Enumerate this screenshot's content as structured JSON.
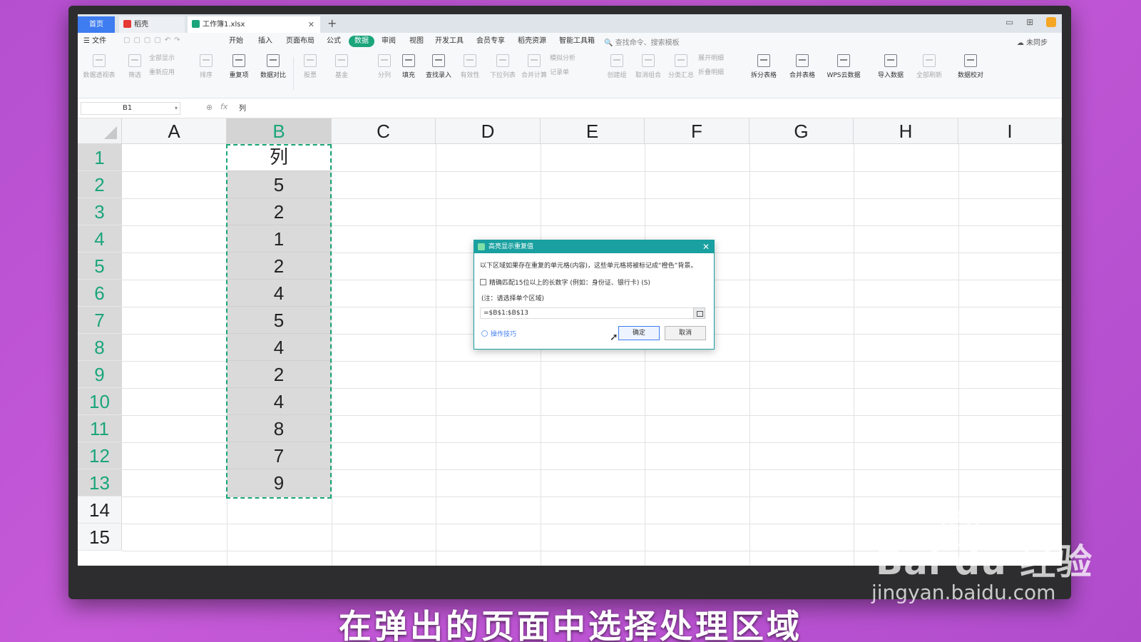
{
  "tabs": {
    "home": "首页",
    "docer": "稻壳",
    "workbook": "工作簿1.xlsx",
    "close": "✕",
    "add": "+"
  },
  "window": {
    "sync": "未同步"
  },
  "menu": {
    "file": "文件",
    "items": [
      "开始",
      "插入",
      "页面布局",
      "公式",
      "数据",
      "审阅",
      "视图",
      "开发工具",
      "会员专享",
      "稻壳资源",
      "智能工具箱"
    ],
    "active_index": 4,
    "search_placeholder": "查找命令、搜索模板"
  },
  "ribbon": {
    "buttons": [
      "数据透视表",
      "筛选",
      "全部显示",
      "重新应用",
      "排序",
      "重复项",
      "数据对比",
      "股票",
      "基金",
      "分列",
      "填充",
      "查找录入",
      "有效性",
      "下拉列表",
      "合并计算",
      "模拟分析",
      "记录单",
      "创建组",
      "取消组合",
      "分类汇总",
      "展开明细",
      "折叠明细",
      "拆分表格",
      "合并表格",
      "WPS云数据",
      "导入数据",
      "全部刷新",
      "数据校对"
    ]
  },
  "formula_bar": {
    "namebox": "B1",
    "fx": "fx",
    "value": "列"
  },
  "sheet": {
    "columns": [
      "A",
      "B",
      "C",
      "D",
      "E",
      "F",
      "G",
      "H",
      "I"
    ],
    "selected_column": "B",
    "rows": [
      "1",
      "2",
      "3",
      "4",
      "5",
      "6",
      "7",
      "8",
      "9",
      "10",
      "11",
      "12",
      "13",
      "14",
      "15"
    ],
    "column_b": [
      "列",
      "5",
      "2",
      "1",
      "2",
      "4",
      "5",
      "4",
      "2",
      "4",
      "8",
      "7",
      "9"
    ]
  },
  "dialog": {
    "title": "高亮显示重复值",
    "description": "以下区域如果存在重复的单元格(内容)，这些单元格将被标记成“橙色”背景。",
    "checkbox_label": "精确匹配15位以上的长数字 (例如：身份证、银行卡) (S)",
    "checkbox_checked": false,
    "note": "(注：请选择单个区域)",
    "range_value": "=$B$1:$B$13",
    "tips": "操作技巧",
    "ok": "确定",
    "cancel": "取消"
  },
  "watermark": {
    "logo": "Bai du 经验",
    "url": "jingyan.baidu.com"
  },
  "caption": "在弹出的页面中选择处理区域",
  "colors": {
    "accent_green": "#1aa57a",
    "dialog_teal": "#1aa0a0",
    "tab_blue": "#3d7cf1",
    "background_purple": "#c157d6"
  }
}
